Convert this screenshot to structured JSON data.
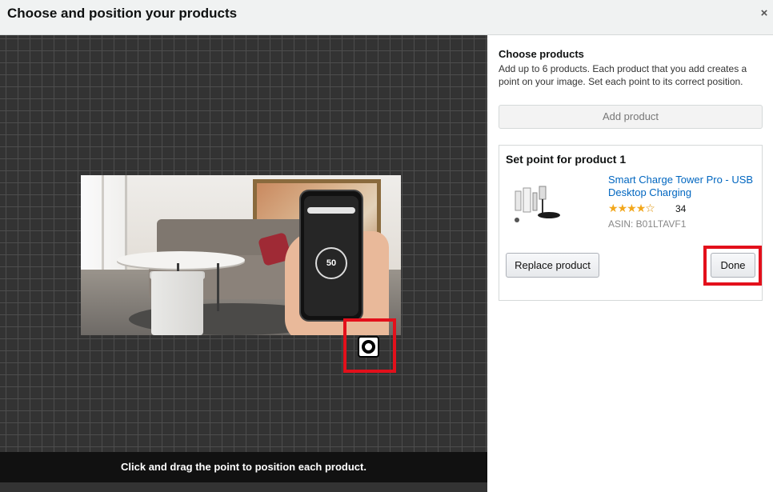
{
  "header": {
    "title": "Choose and position your products",
    "close_label": "×"
  },
  "canvas": {
    "hint": "Click and drag the point to position each product.",
    "phone_dial_value": "50"
  },
  "sidebar": {
    "title": "Choose products",
    "description": "Add up to 6 products. Each product that you add creates a point on your image. Set each point to its correct position.",
    "add_button": "Add product",
    "card": {
      "title": "Set point for product 1",
      "product_name": "Smart Charge Tower Pro - USB Desktop Charging",
      "rating_stars": 4,
      "rating_max": 5,
      "rating_count": "34",
      "asin": "ASIN: B01LTAVF1",
      "replace_button": "Replace product",
      "done_button": "Done"
    }
  },
  "colors": {
    "highlight": "#e3101b",
    "link": "#0066c0",
    "star": "#f2a71c"
  }
}
